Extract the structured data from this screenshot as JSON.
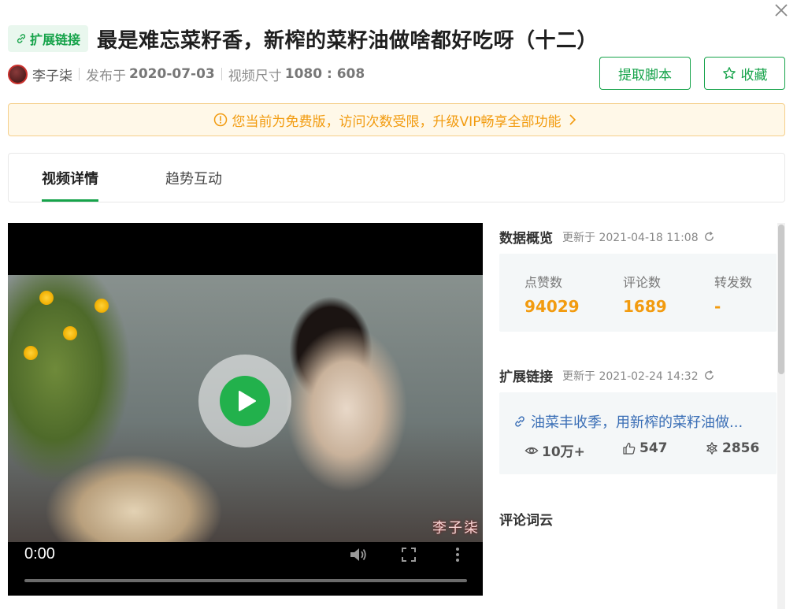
{
  "header": {
    "tag_label": "扩展链接",
    "title": "最是难忘菜籽香，新榨的菜籽油做啥都好吃呀（十二）"
  },
  "meta": {
    "author": "李子柒",
    "published_label": "发布于",
    "published_date": "2020-07-03",
    "size_label": "视频尺寸",
    "size_value": "1080 : 608"
  },
  "actions": {
    "script_button": "提取脚本",
    "favorite_button": "收藏"
  },
  "notice": {
    "text": "您当前为免费版，访问次数受限，升级VIP畅享全部功能"
  },
  "tabs": [
    {
      "label": "视频详情",
      "active": true
    },
    {
      "label": "趋势互动",
      "active": false
    }
  ],
  "video": {
    "current_time": "0:00",
    "watermark": "李子柒"
  },
  "overview": {
    "title": "数据概览",
    "updated": "更新于 2021-04-18 11:08",
    "stats": [
      {
        "label": "点赞数",
        "value": "94029"
      },
      {
        "label": "评论数",
        "value": "1689"
      },
      {
        "label": "转发数",
        "value": "-"
      }
    ]
  },
  "extended_links": {
    "title": "扩展链接",
    "updated": "更新于 2021-02-24 14:32",
    "link_text": "油菜丰收季，用新榨的菜籽油做...",
    "views": "10万+",
    "likes": "547",
    "shares": "2856"
  },
  "word_cloud": {
    "title": "评论词云"
  },
  "colors": {
    "accent": "#16a34a",
    "warning": "#f29b0f",
    "link": "#3b6fb6"
  }
}
